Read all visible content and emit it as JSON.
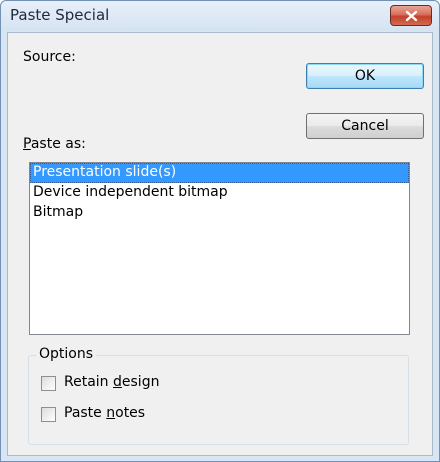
{
  "window": {
    "title": "Paste Special"
  },
  "dialog": {
    "source_label": "Source:",
    "paste_as_prefix": "P",
    "paste_as_rest": "aste as:",
    "ok_label": "OK",
    "cancel_label": "Cancel"
  },
  "paste_as_options": [
    "Presentation slide(s)",
    "Device independent bitmap",
    "Bitmap"
  ],
  "selected_option": "Presentation slide(s)",
  "options": {
    "group_label": "Options",
    "retain_design": {
      "before": "Retain ",
      "accel": "d",
      "after": "esign",
      "checked": false
    },
    "paste_notes": {
      "before": "Paste ",
      "accel": "n",
      "after": "otes",
      "checked": false
    }
  },
  "icons": {
    "close": "close-icon"
  },
  "colors": {
    "selection": "#3399ff",
    "close_button": "#c3412c"
  }
}
